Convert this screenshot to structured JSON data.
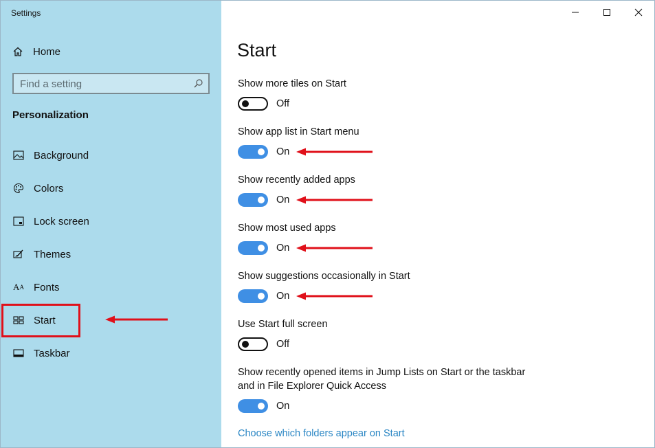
{
  "window": {
    "title": "Settings"
  },
  "sidebar": {
    "home_label": "Home",
    "search_placeholder": "Find a setting",
    "section_title": "Personalization",
    "items": [
      {
        "label": "Background",
        "icon": "image-icon"
      },
      {
        "label": "Colors",
        "icon": "palette-icon"
      },
      {
        "label": "Lock screen",
        "icon": "lock-screen-icon"
      },
      {
        "label": "Themes",
        "icon": "themes-brush-icon"
      },
      {
        "label": "Fonts",
        "icon": "fonts-icon"
      },
      {
        "label": "Start",
        "icon": "start-tiles-icon",
        "selected": true
      },
      {
        "label": "Taskbar",
        "icon": "taskbar-icon"
      }
    ]
  },
  "main": {
    "title": "Start",
    "settings": [
      {
        "label": "Show more tiles on Start",
        "state": "Off",
        "on": false
      },
      {
        "label": "Show app list in Start menu",
        "state": "On",
        "on": true
      },
      {
        "label": "Show recently added apps",
        "state": "On",
        "on": true
      },
      {
        "label": "Show most used apps",
        "state": "On",
        "on": true
      },
      {
        "label": "Show suggestions occasionally in Start",
        "state": "On",
        "on": true
      },
      {
        "label": "Use Start full screen",
        "state": "Off",
        "on": false
      },
      {
        "label_line1": "Show recently opened items in Jump Lists on Start or the taskbar",
        "label_line2": "and in File Explorer Quick Access",
        "state": "On",
        "on": true
      }
    ],
    "link": "Choose which folders appear on Start"
  },
  "colors": {
    "sidebar_bg": "#acdbec",
    "toggle_on": "#3f8fe4",
    "link": "#2a86c4",
    "annotation_red": "#e0101a"
  }
}
